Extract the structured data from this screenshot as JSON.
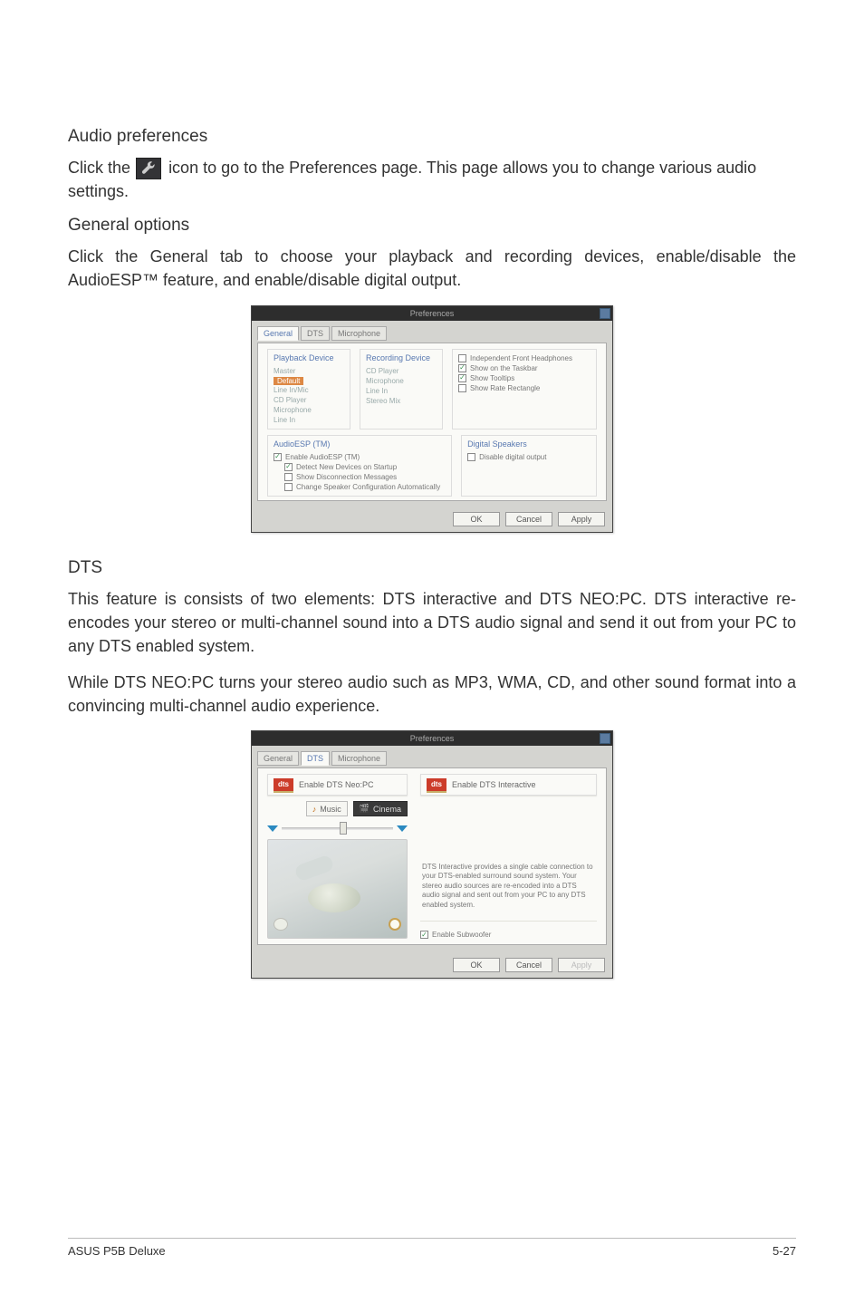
{
  "section1": {
    "title": "Audio preferences",
    "line_a": "Click the",
    "line_b": " icon to go to the Preferences page. This page allows you to change various audio settings."
  },
  "section2": {
    "title": "General options",
    "desc": "Click the General tab to choose your playback and recording devices, enable/disable the AudioESP™ feature, and enable/disable digital output."
  },
  "dialog1": {
    "title": "Preferences",
    "tabs": [
      "General",
      "DTS",
      "Microphone"
    ],
    "playback_label": "Playback Device",
    "playback_items": [
      "Master",
      "Default",
      "Line In/Mic",
      "CD Player",
      "Microphone",
      "Line In"
    ],
    "recording_label": "Recording Device",
    "recording_items": [
      "CD Player",
      "Microphone",
      "Line In",
      "Stereo Mix"
    ],
    "right_checks": [
      {
        "label": "Independent Front Headphones",
        "checked": false
      },
      {
        "label": "Show on the Taskbar",
        "checked": true
      },
      {
        "label": "Show Tooltips",
        "checked": true
      },
      {
        "label": "Show Rate Rectangle",
        "checked": false
      }
    ],
    "audio_esp_label": "AudioESP (TM)",
    "audio_esp_items": [
      {
        "label": "Enable AudioESP (TM)",
        "checked": true,
        "type": "check"
      },
      {
        "label": "Detect New Devices on Startup",
        "checked": true,
        "type": "check"
      },
      {
        "label": "Show Disconnection Messages",
        "checked": false,
        "type": "check"
      },
      {
        "label": "Change Speaker Configuration Automatically",
        "checked": false,
        "type": "check"
      }
    ],
    "digital_label": "Digital Speakers",
    "digital_opt": {
      "label": "Disable digital output",
      "checked": false
    },
    "buttons": [
      "OK",
      "Cancel",
      "Apply"
    ]
  },
  "section3": {
    "title": "DTS",
    "p1": "This feature is consists of two elements: DTS interactive and DTS NEO:PC. DTS interactive re-encodes your stereo or multi-channel sound into a DTS audio signal and send it out from your PC to any DTS enabled system.",
    "p2": "While DTS NEO:PC turns your stereo audio such as MP3, WMA, CD, and other sound format into a convincing multi-channel audio experience."
  },
  "dialog2": {
    "title": "Preferences",
    "tabs": [
      "General",
      "DTS",
      "Microphone"
    ],
    "left_head": "Enable DTS Neo:PC",
    "music_label": "Music",
    "cinema_label": "Cinema",
    "right_head": "Enable DTS Interactive",
    "right_desc": "DTS Interactive provides a single cable connection to your DTS-enabled surround sound system. Your stereo audio sources are re-encoded into a DTS audio signal and sent out from your PC to any DTS enabled system.",
    "sub_label": "Enable Subwoofer",
    "buttons": [
      "OK",
      "Cancel",
      "Apply"
    ]
  },
  "footer": {
    "left": "ASUS P5B Deluxe",
    "right": "5-27"
  }
}
